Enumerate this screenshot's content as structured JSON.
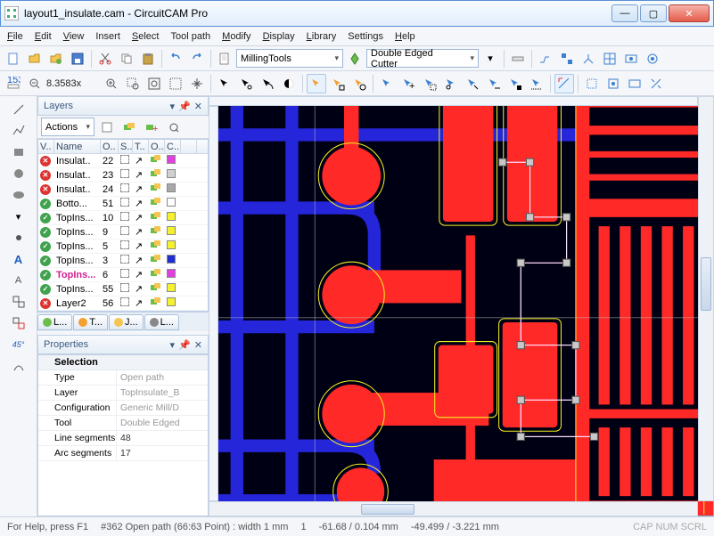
{
  "window": {
    "title": "layout1_insulate.cam - CircuitCAM Pro"
  },
  "menu": [
    "File",
    "Edit",
    "View",
    "Insert",
    "Select",
    "Tool path",
    "Modify",
    "Display",
    "Library",
    "Settings",
    "Help"
  ],
  "menu_underline": [
    0,
    0,
    0,
    -1,
    0,
    -1,
    0,
    0,
    0,
    -1,
    0
  ],
  "toolbar1": {
    "combo1": "MillingTools",
    "combo2": "Double Edged Cutter"
  },
  "zoom": "8.3583x",
  "layers": {
    "title": "Layers",
    "actions": "Actions",
    "cols": [
      "V..",
      "Name",
      "O..",
      "S..",
      "T..",
      "O..",
      "C.."
    ],
    "rows": [
      {
        "st": "no",
        "name": "Insulat..",
        "n": "22",
        "c": "#e040e0"
      },
      {
        "st": "no",
        "name": "Insulat..",
        "n": "23",
        "c": "#d0d0d0"
      },
      {
        "st": "no",
        "name": "Insulat..",
        "n": "24",
        "c": "#a8a8a8"
      },
      {
        "st": "ok",
        "name": "Botto...",
        "n": "51",
        "c": "#ffffff"
      },
      {
        "st": "ok",
        "name": "TopIns...",
        "n": "10",
        "c": "#f5f030"
      },
      {
        "st": "ok",
        "name": "TopIns...",
        "n": "9",
        "c": "#f5f030"
      },
      {
        "st": "ok",
        "name": "TopIns...",
        "n": "5",
        "c": "#f5f030"
      },
      {
        "st": "ok",
        "name": "TopIns...",
        "n": "3",
        "c": "#2030d0"
      },
      {
        "st": "ok",
        "name": "TopIns...",
        "n": "6",
        "c": "#e040e0",
        "sel": true
      },
      {
        "st": "ok",
        "name": "TopIns...",
        "n": "55",
        "c": "#f5f030"
      },
      {
        "st": "no",
        "name": "Layer2",
        "n": "56",
        "c": "#f5f030"
      }
    ],
    "tabs": [
      "L...",
      "T...",
      "J...",
      "L..."
    ]
  },
  "properties": {
    "title": "Properties",
    "section": "Selection",
    "rows": [
      {
        "k": "Type",
        "v": "Open path",
        "ro": true
      },
      {
        "k": "Layer",
        "v": "TopInsulate_B",
        "ro": true
      },
      {
        "k": "Configuration",
        "v": "Generic Mill/D",
        "ro": true
      },
      {
        "k": "Tool",
        "v": "Double Edged",
        "ro": true
      },
      {
        "k": "Line segments",
        "v": "48",
        "ro": false
      },
      {
        "k": "Arc segments",
        "v": "17",
        "ro": false
      }
    ]
  },
  "status": {
    "help": "For Help, press F1",
    "sel": "#362 Open path (66:63 Point) : width 1 mm",
    "count": "1",
    "xy1": "-61.68 / 0.104 mm",
    "xy2": "-49.499 / -3.221 mm",
    "caps": "CAP   NUM   SCRL"
  }
}
